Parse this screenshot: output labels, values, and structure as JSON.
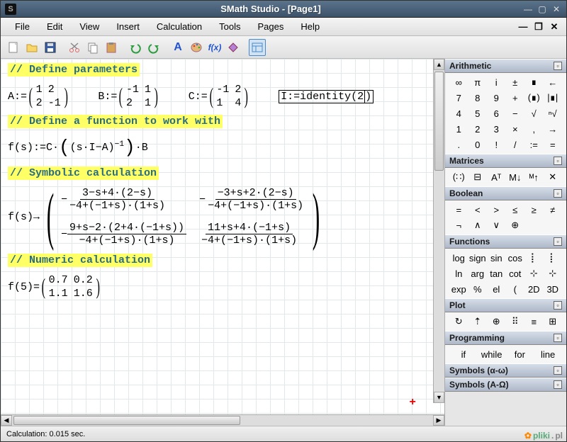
{
  "window": {
    "title": "SMath Studio - [Page1]",
    "icon_letter": "S"
  },
  "menu": {
    "items": [
      "File",
      "Edit",
      "View",
      "Insert",
      "Calculation",
      "Tools",
      "Pages",
      "Help"
    ]
  },
  "toolbar": {
    "icons": [
      "new-doc",
      "open-doc",
      "save-doc",
      "cut",
      "copy",
      "paste",
      "undo",
      "redo",
      "font-a",
      "palette",
      "fx",
      "diamond",
      "panel-toggle"
    ]
  },
  "content": {
    "c1": "// Define parameters",
    "A_label": "A:=",
    "A": [
      [
        "1",
        "2"
      ],
      [
        "2",
        "-1"
      ]
    ],
    "B_label": "B:=",
    "B": [
      [
        "-1",
        "1"
      ],
      [
        "2",
        "1"
      ]
    ],
    "C_label": "C:=",
    "C": [
      [
        "-1",
        "2"
      ],
      [
        "1",
        "4"
      ]
    ],
    "I_label": "I:=",
    "I_call": "identity",
    "I_arg": "2",
    "c2": "// Define a function to work with",
    "f_def_lhs": "f(s):=C·",
    "f_def_inner": "(s·I−A)",
    "f_def_exp": "−1",
    "f_def_rhs": "·B",
    "c3": "// Symbolic calculation",
    "sym_lhs": "f(s)→",
    "sym": {
      "n11": "3−s+4·(2−s)",
      "d11": "−4+(−1+s)·(1+s)",
      "s11": "−",
      "n12": "−3+s+2·(2−s)",
      "d12": "−4+(−1+s)·(1+s)",
      "s12": "−",
      "n21": "9+s−2·(2+4·(−1+s))",
      "d21": "−4+(−1+s)·(1+s)",
      "s21": "−",
      "n22": "11+s+4·(−1+s)",
      "d22": "−4+(−1+s)·(1+s)",
      "s22": ""
    },
    "c4": "// Numeric calculation",
    "num_lhs": "f(5)=",
    "num": [
      [
        "0.7",
        "0.2"
      ],
      [
        "1.1",
        "1.6"
      ]
    ]
  },
  "panels": {
    "arithmetic": {
      "title": "Arithmetic",
      "rows": [
        [
          "∞",
          "π",
          "i",
          "±",
          "∎",
          "←"
        ],
        [
          "7",
          "8",
          "9",
          "+",
          "(∎)",
          "|∎|"
        ],
        [
          "4",
          "5",
          "6",
          "−",
          "√",
          "ⁿ√"
        ],
        [
          "1",
          "2",
          "3",
          "×",
          ",",
          "→"
        ],
        [
          ".",
          "0",
          "!",
          "/",
          ":=",
          "="
        ]
      ]
    },
    "matrices": {
      "title": "Matrices",
      "row": [
        "(∷)",
        "⊟",
        "Aᵀ",
        "M↓",
        "ᴹ↑",
        "✕"
      ]
    },
    "boolean": {
      "title": "Boolean",
      "rows": [
        [
          "=",
          "<",
          ">",
          "≤",
          "≥",
          "≠"
        ],
        [
          "¬",
          "∧",
          "∨",
          "⊕",
          "",
          ""
        ]
      ]
    },
    "functions": {
      "title": "Functions",
      "rows": [
        [
          "log",
          "sign",
          "sin",
          "cos",
          "⡇",
          "⡇"
        ],
        [
          "ln",
          "arg",
          "tan",
          "cot",
          "⊹",
          "⊹"
        ],
        [
          "exp",
          "%",
          "el",
          "(",
          "2D",
          "3D"
        ]
      ]
    },
    "plot": {
      "title": "Plot",
      "row": [
        "↻",
        "⇡",
        "⊕",
        "⠿",
        "≡",
        "⊞"
      ]
    },
    "programming": {
      "title": "Programming",
      "row": [
        "if",
        "while",
        "for",
        "line"
      ]
    },
    "symbols_lc": {
      "title": "Symbols (α-ω)"
    },
    "symbols_uc": {
      "title": "Symbols (A-Ω)"
    }
  },
  "status": {
    "text": "Calculation: 0.015 sec."
  },
  "watermark": {
    "text": "pliki",
    "suffix": "pl"
  }
}
